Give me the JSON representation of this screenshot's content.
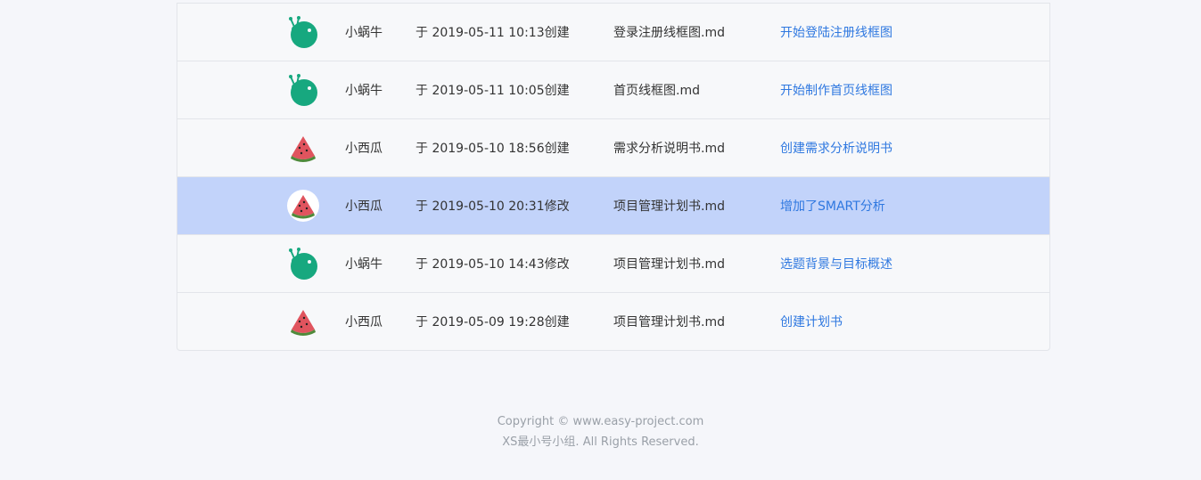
{
  "colors": {
    "page_background": "#f5f6fa",
    "row_highlight": "#c2d3fa",
    "link": "#2f78e0",
    "snail_avatar": "#17a87f"
  },
  "rows": [
    {
      "avatar": "snail-avatar-icon",
      "user": "小蜗牛",
      "time": "于 2019-05-11 10:13创建",
      "file": "登录注册线框图.md",
      "message": "开始登陆注册线框图",
      "highlighted": false
    },
    {
      "avatar": "snail-avatar-icon",
      "user": "小蜗牛",
      "time": "于 2019-05-11 10:05创建",
      "file": "首页线框图.md",
      "message": "开始制作首页线框图",
      "highlighted": false
    },
    {
      "avatar": "watermelon-avatar-icon",
      "user": "小西瓜",
      "time": "于 2019-05-10 18:56创建",
      "file": "需求分析说明书.md",
      "message": "创建需求分析说明书",
      "highlighted": false
    },
    {
      "avatar": "watermelon-avatar-icon",
      "user": "小西瓜",
      "time": "于 2019-05-10 20:31修改",
      "file": "项目管理计划书.md",
      "message": "增加了SMART分析",
      "highlighted": true
    },
    {
      "avatar": "snail-avatar-icon",
      "user": "小蜗牛",
      "time": "于 2019-05-10 14:43修改",
      "file": "项目管理计划书.md",
      "message": "选题背景与目标概述",
      "highlighted": false
    },
    {
      "avatar": "watermelon-avatar-icon",
      "user": "小西瓜",
      "time": "于 2019-05-09 19:28创建",
      "file": "项目管理计划书.md",
      "message": "创建计划书",
      "highlighted": false
    }
  ],
  "footer": {
    "copyright": "Copyright © www.easy-project.com",
    "rights": "XS最小号小组. All Rights Reserved."
  }
}
